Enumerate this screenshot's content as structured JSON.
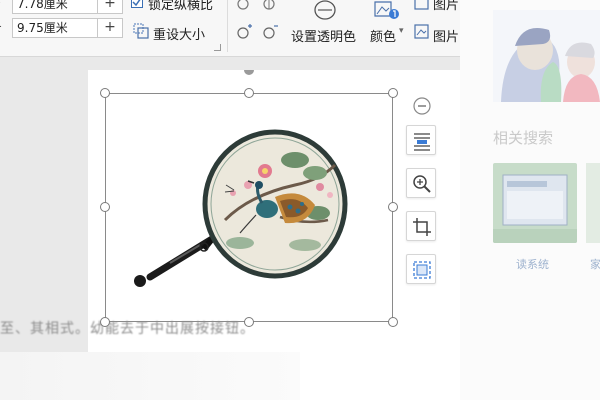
{
  "ribbon": {
    "height_value": "7.78厘米",
    "width_value": "9.75厘米",
    "plus_symbol": "+",
    "minus_symbol": "-",
    "lock_ratio_label": "锁定纵横比",
    "reset_size_label": "重设大小",
    "set_transparent_label": "设置透明色",
    "color_label": "颜色",
    "picture_label_top": "图片",
    "picture_label_bottom": "图片"
  },
  "document": {
    "faded_text": "至、其相式。幼能去于中出展按接钮。"
  },
  "right_panel": {
    "related_search_title": "相关搜索",
    "result_caption": "读系统",
    "result_caption_2": "家"
  },
  "colors": {
    "ribbon_bg": "#f7f7f7",
    "canvas_bg": "#e9e9e9",
    "selection_border": "#8a8a8a",
    "link_blue": "#9fb3cf"
  }
}
